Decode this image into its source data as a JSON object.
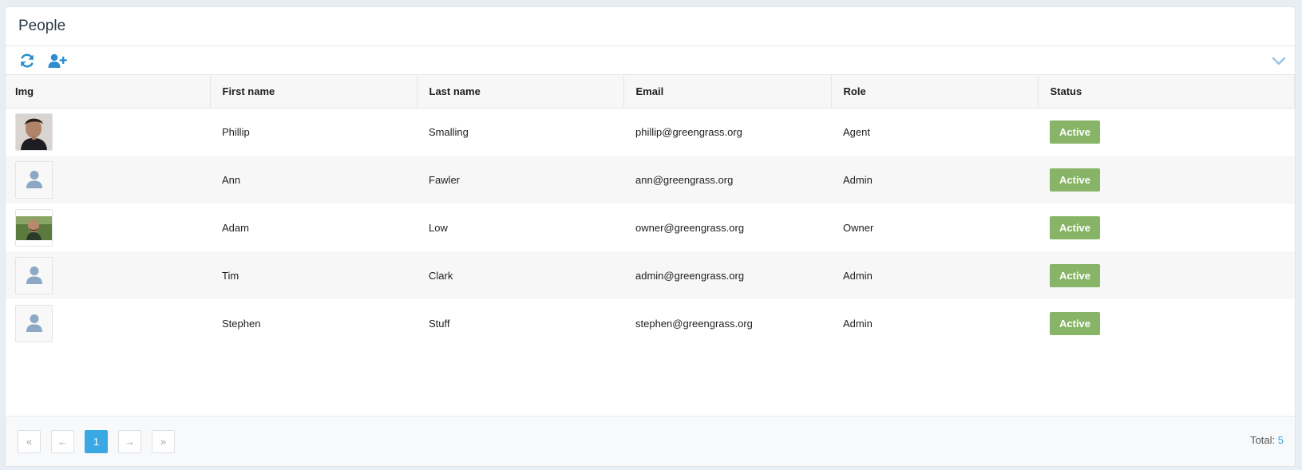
{
  "page": {
    "title": "People"
  },
  "toolbar": {
    "refresh_icon": "refresh-icon",
    "add_icon": "add-user-icon",
    "collapse_icon": "chevron-down-icon"
  },
  "table": {
    "columns": [
      "Img",
      "First name",
      "Last name",
      "Email",
      "Role",
      "Status"
    ],
    "rows": [
      {
        "img": "photo",
        "first": "Phillip",
        "last": "Smalling",
        "email": "phillip@greengrass.org",
        "role": "Agent",
        "status": "Active"
      },
      {
        "img": "placeholder",
        "first": "Ann",
        "last": "Fawler",
        "email": "ann@greengrass.org",
        "role": "Admin",
        "status": "Active"
      },
      {
        "img": "photo",
        "first": "Adam",
        "last": "Low",
        "email": "owner@greengrass.org",
        "role": "Owner",
        "status": "Active"
      },
      {
        "img": "placeholder",
        "first": "Tim",
        "last": "Clark",
        "email": "admin@greengrass.org",
        "role": "Admin",
        "status": "Active"
      },
      {
        "img": "placeholder",
        "first": "Stephen",
        "last": "Stuff",
        "email": "stephen@greengrass.org",
        "role": "Admin",
        "status": "Active"
      }
    ]
  },
  "pagination": {
    "first_icon": "«",
    "prev_icon": "←",
    "current": "1",
    "next_icon": "→",
    "last_icon": "»",
    "total_label": "Total:",
    "total_value": "5"
  },
  "colors": {
    "accent": "#3aa8e2",
    "status_active": "#87b466"
  }
}
